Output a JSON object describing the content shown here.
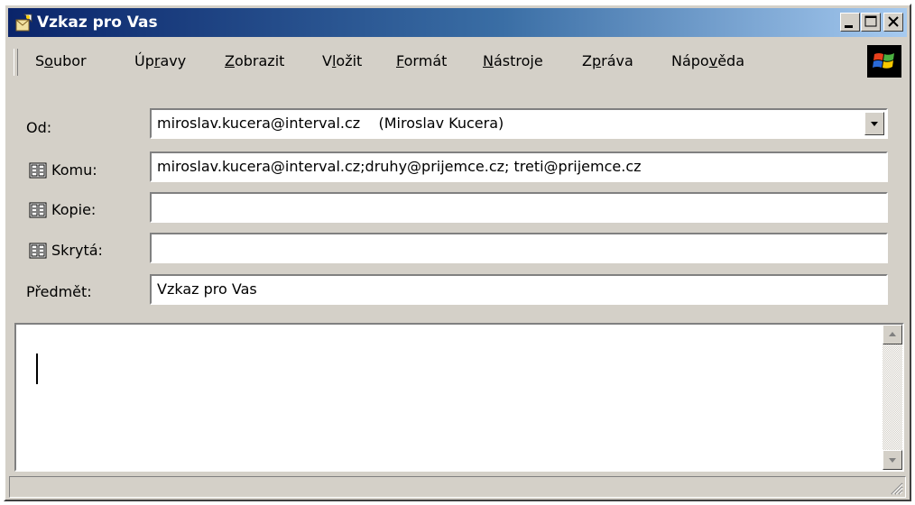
{
  "window": {
    "title": "Vzkaz pro Vas",
    "accent_color": "#0a246a",
    "face_color": "#d4d0c8"
  },
  "title_buttons": [
    "minimize-icon",
    "maximize-icon",
    "close-icon"
  ],
  "menu": {
    "items": [
      {
        "pre": "S",
        "acc": "o",
        "post": "ubor"
      },
      {
        "pre": "Úp",
        "acc": "r",
        "post": "avy"
      },
      {
        "pre": "",
        "acc": "Z",
        "post": "obrazit"
      },
      {
        "pre": "V",
        "acc": "l",
        "post": "ožit"
      },
      {
        "pre": "",
        "acc": "F",
        "post": "ormát"
      },
      {
        "pre": "",
        "acc": "N",
        "post": "ástroje"
      },
      {
        "pre": "Z",
        "acc": "p",
        "post": "ráva"
      },
      {
        "pre": "Nápo",
        "acc": "v",
        "post": "ěda"
      }
    ]
  },
  "header": {
    "from_label": "Od:",
    "from_value": "miroslav.kucera@interval.cz    (Miroslav Kucera)",
    "to_label": "Komu:",
    "to_value": "miroslav.kucera@interval.cz;druhy@prijemce.cz; treti@prijemce.cz",
    "cc_label": "Kopie:",
    "cc_value": "",
    "bcc_label": "Skrytá:",
    "bcc_value": "",
    "subject_label": "Předmět:",
    "subject_value": "Vzkaz pro Vas"
  },
  "body": {
    "text": ""
  }
}
